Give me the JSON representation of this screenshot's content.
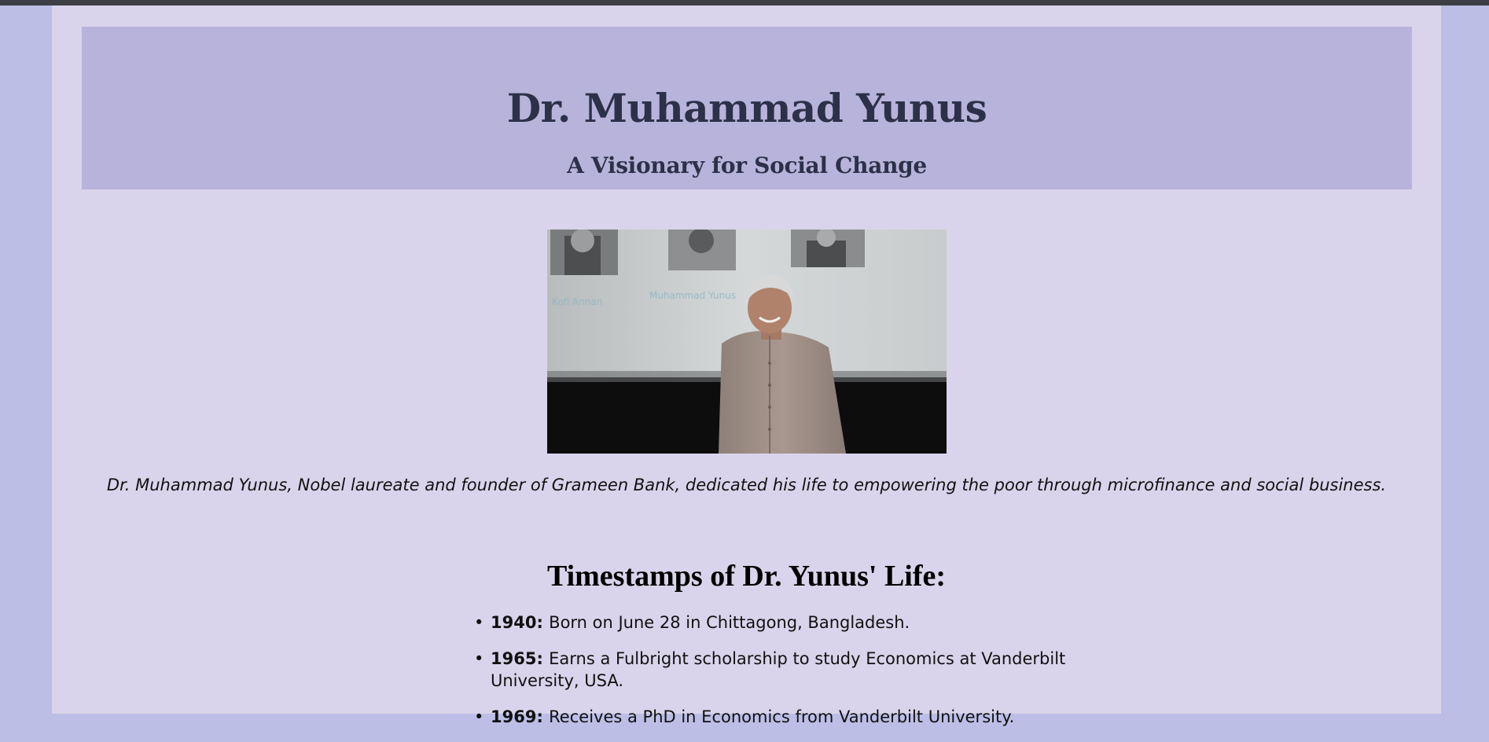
{
  "header": {
    "title": "Dr. Muhammad Yunus",
    "subtitle": "A Visionary for Social Change"
  },
  "portrait": {
    "caption": "Dr. Muhammad Yunus, Nobel laureate and founder of Grameen Bank, dedicated his life to empowering the poor through microfinance and social business.",
    "background_labels": [
      "Kofi Annan",
      "Muhammad Yunus"
    ]
  },
  "timeline": {
    "title": "Timestamps of Dr. Yunus' Life:",
    "items": [
      {
        "year": "1940:",
        "text": "Born on June 28 in Chittagong, Bangladesh."
      },
      {
        "year": "1965:",
        "text": "Earns a Fulbright scholarship to study Economics at Vanderbilt University, USA."
      },
      {
        "year": "1969:",
        "text": "Receives a PhD in Economics from Vanderbilt University."
      }
    ]
  },
  "colors": {
    "page_bg": "#bdbee6",
    "container_bg": "#d9d4eb",
    "header_bg": "#b8b3da",
    "header_text": "#2c3048",
    "topbar": "#3e3f45"
  }
}
